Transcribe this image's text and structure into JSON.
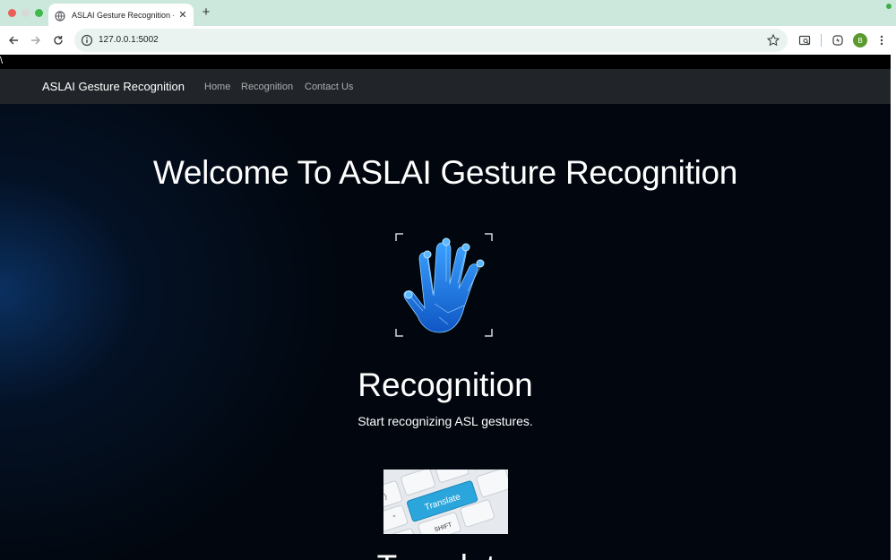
{
  "browser": {
    "tab": {
      "title": "ASLAI Gesture Recognition -"
    },
    "url": "127.0.0.1:5002",
    "profile_initial": "B"
  },
  "page": {
    "stray_text": "\\",
    "navbar": {
      "brand": "ASLAI Gesture Recognition",
      "links": [
        "Home",
        "Recognition",
        "Contact Us"
      ]
    },
    "hero": {
      "heading": "Welcome To ASLAI Gesture Recognition"
    },
    "sections": [
      {
        "title": "Recognition",
        "description": "Start recognizing ASL gestures.",
        "image": "hand-scan-icon"
      },
      {
        "title": "Translate",
        "image": "keyboard-translate-key",
        "key_labels": [
          "Translate",
          "SHIFT"
        ]
      }
    ]
  },
  "colors": {
    "page_bg": "#02070f",
    "navbar_bg": "#212529",
    "hand_blue": "#1e7fe0",
    "translate_key": "#2aa6dc"
  }
}
